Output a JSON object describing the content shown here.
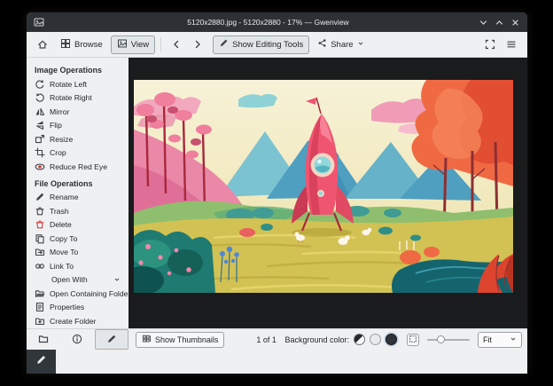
{
  "titlebar": {
    "title": "5120x2880.jpg - 5120x2880 - 17% — Gwenview"
  },
  "toolbar": {
    "browse_label": "Browse",
    "view_label": "View",
    "editing_tools_label": "Show Editing Tools",
    "share_label": "Share"
  },
  "sidebar": {
    "sections": [
      {
        "title": "Image Operations",
        "items": [
          {
            "label": "Rotate Left",
            "icon": "rotate-left"
          },
          {
            "label": "Rotate Right",
            "icon": "rotate-right"
          },
          {
            "label": "Mirror",
            "icon": "mirror"
          },
          {
            "label": "Flip",
            "icon": "flip"
          },
          {
            "label": "Resize",
            "icon": "resize"
          },
          {
            "label": "Crop",
            "icon": "crop"
          },
          {
            "label": "Reduce Red Eye",
            "icon": "red-eye"
          }
        ]
      },
      {
        "title": "File Operations",
        "items": [
          {
            "label": "Rename",
            "icon": "rename"
          },
          {
            "label": "Trash",
            "icon": "trash"
          },
          {
            "label": "Delete",
            "icon": "delete"
          },
          {
            "label": "Copy To",
            "icon": "copy"
          },
          {
            "label": "Move To",
            "icon": "move"
          },
          {
            "label": "Link To",
            "icon": "link"
          },
          {
            "label": "Open With",
            "icon": null,
            "indent": true,
            "chevron": true
          },
          {
            "label": "Open Containing Folder",
            "icon": "folder-open"
          },
          {
            "label": "Properties",
            "icon": "properties"
          },
          {
            "label": "Create Folder",
            "icon": "folder-new"
          }
        ]
      }
    ]
  },
  "statusbar": {
    "show_thumbnails_label": "Show Thumbnails",
    "counter": "1 of 1",
    "background_color_label": "Background color:",
    "zoom_mode": "Fit"
  },
  "colors": {
    "titlebar_bg": "#2d3135",
    "chrome_bg": "#eff0f1",
    "canvas_bg": "#191b1d",
    "delete_red": "#d43f3f"
  }
}
